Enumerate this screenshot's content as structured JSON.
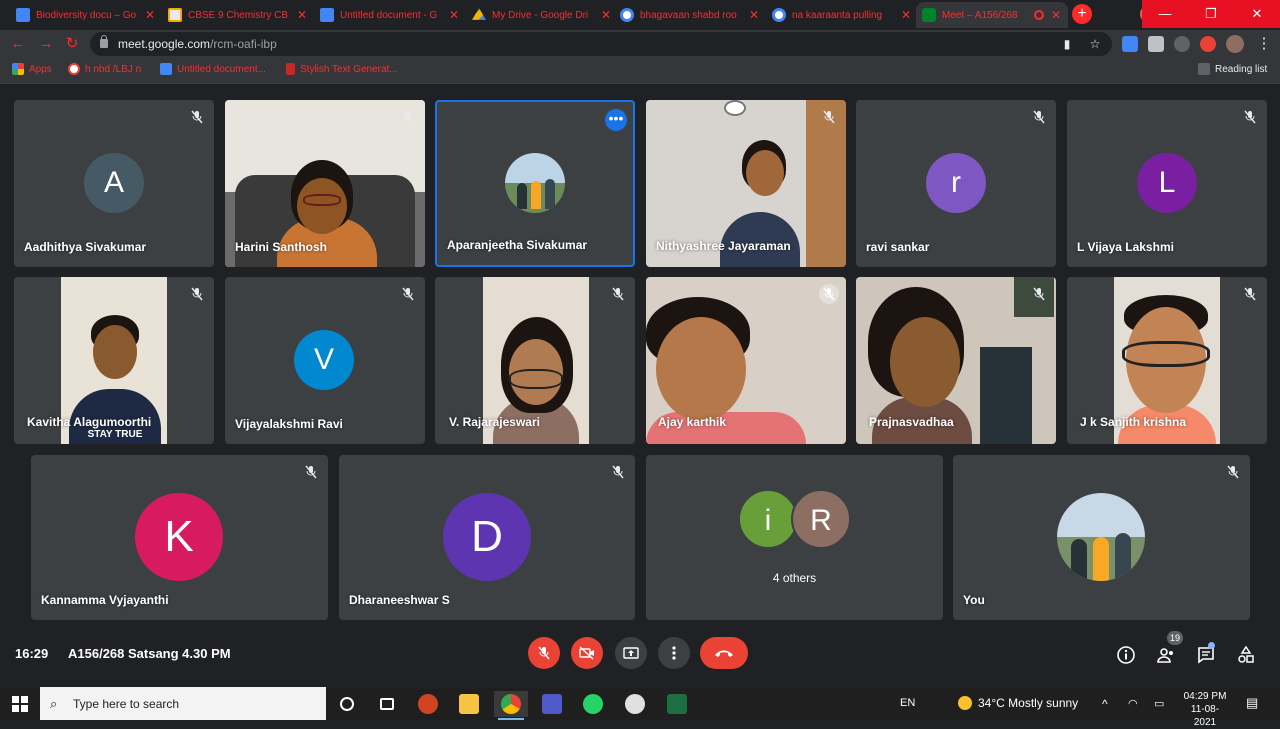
{
  "browser": {
    "tabs": [
      {
        "title": "Biodiversity docu – Go",
        "icon": "docs-icon"
      },
      {
        "title": "CBSE 9 Chemistry CB",
        "icon": "cbse-icon"
      },
      {
        "title": "Untitled document - G",
        "icon": "docs-icon"
      },
      {
        "title": "My Drive - Google Dri",
        "icon": "drive-icon"
      },
      {
        "title": "bhagavaan shabd roo",
        "icon": "google-icon"
      },
      {
        "title": "na kaaraanta pulling",
        "icon": "google-icon"
      },
      {
        "title": "Meet – A156/268",
        "icon": "meet-icon"
      }
    ],
    "url_host": "meet.google.com",
    "url_path": "/rcm-oafi-ibp",
    "bookmarks": [
      {
        "label": "Apps"
      },
      {
        "label": "h nbd /LBJ n"
      },
      {
        "label": "Untitled document..."
      },
      {
        "label": "Stylish Text Generat..."
      }
    ],
    "reading_list": "Reading list"
  },
  "meet": {
    "participants": [
      {
        "name": "Aadhithya Sivakumar",
        "initial": "A",
        "color": "#455a64"
      },
      {
        "name": "Harini Santhosh"
      },
      {
        "name": "Aparanjeetha Sivakumar"
      },
      {
        "name": "Nithyashree Jayaraman"
      },
      {
        "name": "ravi sankar",
        "initial": "r",
        "color": "#7e57c2"
      },
      {
        "name": "L Vijaya Lakshmi",
        "initial": "L",
        "color": "#7b1fa2"
      },
      {
        "name": "Kavitha Alagumoorthi",
        "shirt_text": "STAY TRUE"
      },
      {
        "name": "Vijayalakshmi Ravi",
        "initial": "V",
        "color": "#0288d1"
      },
      {
        "name": "V. Rajarajeswari"
      },
      {
        "name": "Ajay karthik"
      },
      {
        "name": "Prajnasvadhaa"
      },
      {
        "name": "J k Sanjith krishna"
      },
      {
        "name": "Kannamma Vyjayanthi",
        "initial": "K",
        "color": "#d81b60"
      },
      {
        "name": "Dharaneeshwar S",
        "initial": "D",
        "color": "#5e35b1"
      },
      {
        "name": "You"
      }
    ],
    "others": {
      "label": "4 others",
      "initials": [
        {
          "initial": "i",
          "color": "#689f38"
        },
        {
          "initial": "R",
          "color": "#8d6e63"
        }
      ]
    },
    "clock": "16:29",
    "meeting_title": "A156/268 Satsang 4.30 PM",
    "people_count": "19"
  },
  "taskbar": {
    "search_placeholder": "Type here to search",
    "lang": "EN",
    "weather": "34°C  Mostly sunny",
    "time": "04:29 PM",
    "date": "11-08-2021"
  }
}
